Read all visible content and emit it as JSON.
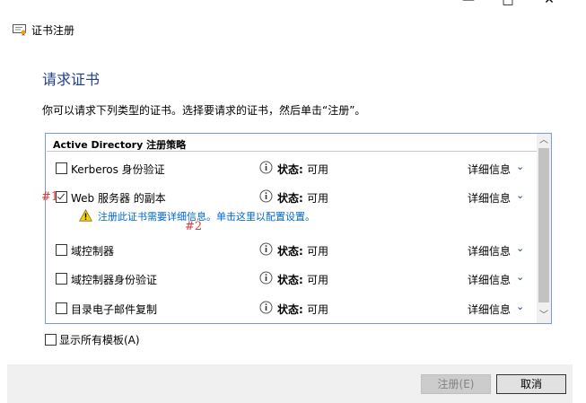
{
  "window": {
    "minimize_glyph": "—",
    "maximize_glyph": "□",
    "close_glyph": "✕",
    "title": "证书注册"
  },
  "page": {
    "heading": "请求证书",
    "description": "你可以请求下列类型的证书。选择要请求的证书，然后单击“注册”。"
  },
  "policy": {
    "header": "Active Directory 注册策略",
    "status_label": "状态:",
    "details_label": "详细信息",
    "items": [
      {
        "name": "Kerberos 身份验证",
        "status": "可用",
        "checked": false
      },
      {
        "name": "Web 服务器 的副本",
        "status": "可用",
        "checked": true
      },
      {
        "name": "域控制器",
        "status": "可用",
        "checked": false
      },
      {
        "name": "域控制器身份验证",
        "status": "可用",
        "checked": false
      },
      {
        "name": "目录电子邮件复制",
        "status": "可用",
        "checked": false
      }
    ],
    "warning": "注册此证书需要详细信息。单击这里以配置设置。"
  },
  "annotations": {
    "marker1": "#1",
    "marker2": "#2"
  },
  "options": {
    "show_all_templates": "显示所有模板(A)"
  },
  "buttons": {
    "enroll": "注册(E)",
    "cancel": "取消"
  },
  "colors": {
    "heading": "#1e3f8a",
    "link": "#0066cc",
    "annotation": "#e03a3a"
  }
}
